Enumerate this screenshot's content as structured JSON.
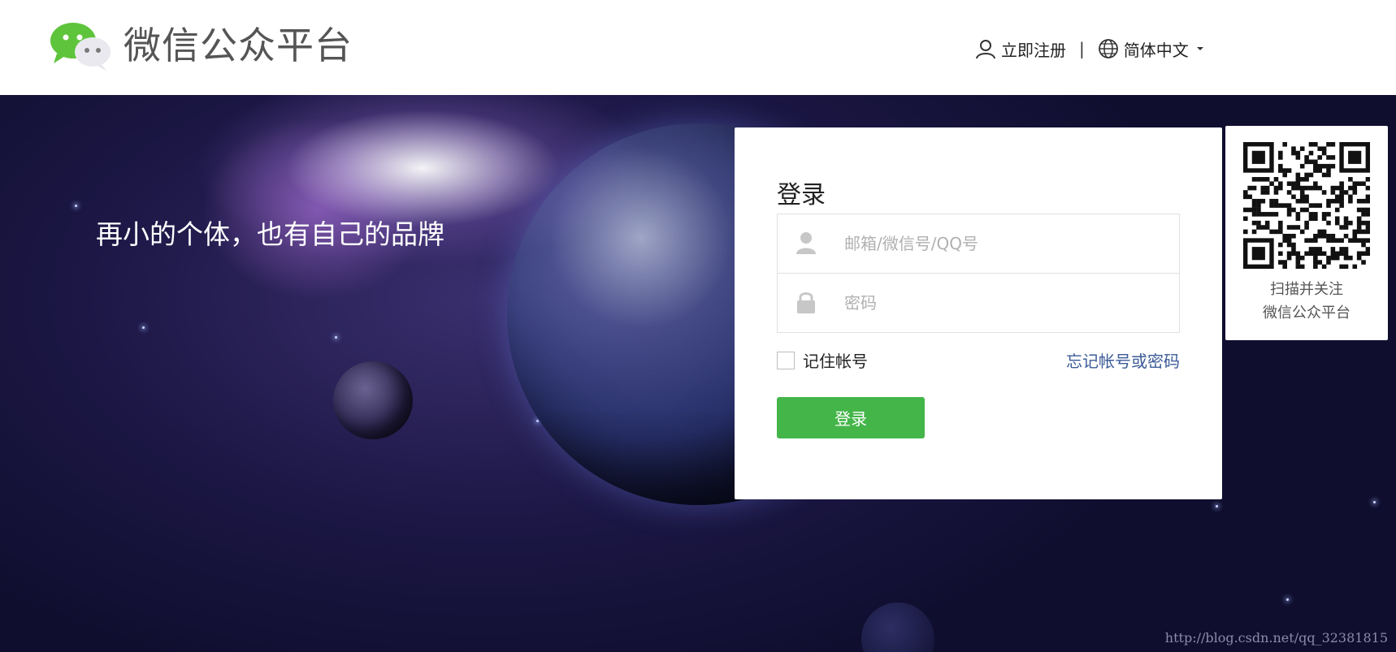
{
  "header": {
    "brand_title": "微信公众平台",
    "register_label": "立即注册",
    "separator": "|",
    "language_label": "简体中文"
  },
  "hero": {
    "slogan": "再小的个体，也有自己的品牌"
  },
  "login": {
    "title": "登录",
    "username_placeholder": "邮箱/微信号/QQ号",
    "password_placeholder": "密码",
    "remember_label": "记住帐号",
    "forgot_label": "忘记帐号或密码",
    "submit_label": "登录"
  },
  "qr": {
    "caption_line1": "扫描并关注",
    "caption_line2": "微信公众平台"
  },
  "watermark": "http://blog.csdn.net/qq_32381815",
  "colors": {
    "accent": "#44b549",
    "link": "#3b5b98"
  }
}
